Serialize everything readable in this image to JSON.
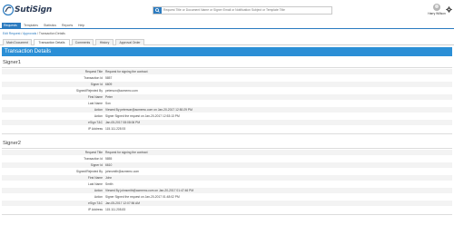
{
  "header": {
    "logo_text": "SutiSign",
    "search_placeholder": "Request Title or Document Name or Signer Email or Notification Subject or Template Title",
    "user_name": "Harry Willson"
  },
  "nav": {
    "items": [
      "Requests",
      "Templates",
      "Statistics",
      "Reports",
      "Help"
    ],
    "active_index": 0
  },
  "breadcrumb": {
    "link1": "Edit Request",
    "sep1": " / ",
    "link2": "Approvals",
    "sep2": " / ",
    "current": "Transaction Details"
  },
  "tabs": {
    "items": [
      "Main Document",
      "Transaction Details",
      "Comments",
      "History",
      "Approval Order"
    ],
    "active_index": 1
  },
  "panel": {
    "title": "Transaction Details"
  },
  "signers": [
    {
      "title": "Signer1",
      "fields": [
        {
          "label": "Request Title",
          "value": "Request for signing the contract"
        },
        {
          "label": "Transaction Id",
          "value": "5857"
        },
        {
          "label": "Signer Id",
          "value": "6609"
        },
        {
          "label": "Signed/Rejected By",
          "value": "peterson@acmemc.com"
        },
        {
          "label": "First Name",
          "value": "Peter"
        },
        {
          "label": "Last Name",
          "value": "Son"
        },
        {
          "label": "Action",
          "value": "Viewed By peterson@acmemc.com on Jan-20-2017 12:50:29 PM"
        },
        {
          "label": "Action",
          "value": "Signer Signed the request on Jan-20-2017 12:53:13 PM"
        },
        {
          "label": "eSign T&C",
          "value": "Jan-05-2017 08:08:06 PM"
        },
        {
          "label": "IP Address",
          "value": "115.111.228.93"
        }
      ]
    },
    {
      "title": "Signer2",
      "fields": [
        {
          "label": "Request Title",
          "value": "Request for signing the contract"
        },
        {
          "label": "Transaction Id",
          "value": "5855"
        },
        {
          "label": "Signer Id",
          "value": "6610"
        },
        {
          "label": "Signed/Rejected By",
          "value": "johnsmith@acmemc.com"
        },
        {
          "label": "First Name",
          "value": "John"
        },
        {
          "label": "Last Name",
          "value": "Smith"
        },
        {
          "label": "Action",
          "value": "Viewed By johnsmith@acmemc.com on Jan-20-2017 01:47:46 PM"
        },
        {
          "label": "Action",
          "value": "Signer Signed the request on Jan-20-2017 01:48:02 PM"
        },
        {
          "label": "eSign T&C",
          "value": "Jan-05-2017 12:07:56 AM"
        },
        {
          "label": "IP Address",
          "value": "115.111.208.83"
        }
      ]
    }
  ],
  "colors": {
    "accent": "#2b7bc0",
    "panel_header": "#2b8fd6",
    "row_shade": "#f3f3f3"
  }
}
